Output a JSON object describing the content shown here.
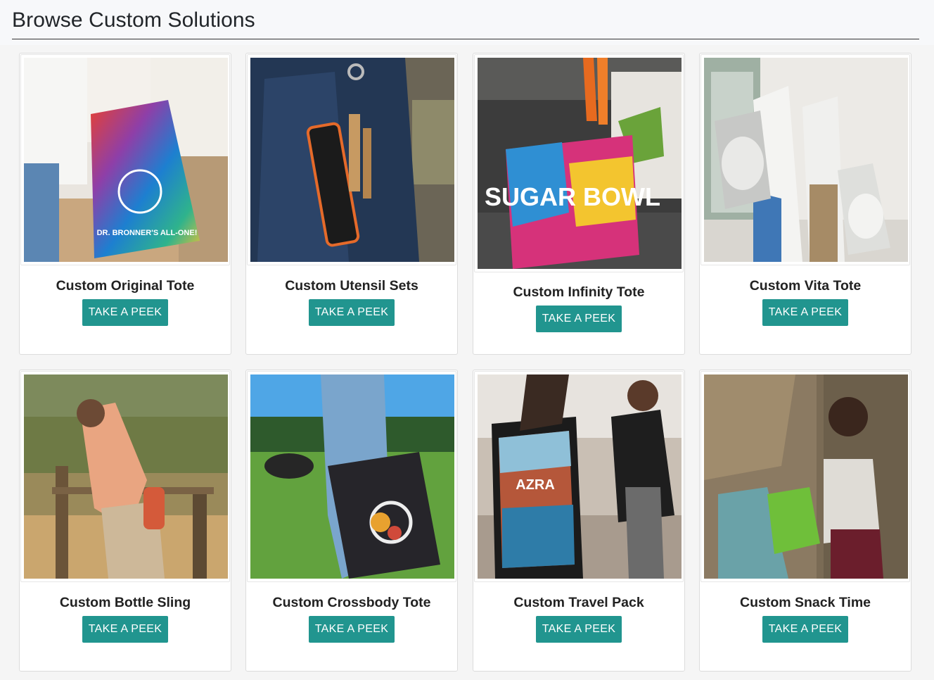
{
  "page": {
    "title": "Browse Custom Solutions"
  },
  "products": [
    {
      "name": "Custom Original Tote",
      "button_label": "TAKE A PEEK",
      "icon": "product-photo-original-tote"
    },
    {
      "name": "Custom Utensil Sets",
      "button_label": "TAKE A PEEK",
      "icon": "product-photo-utensil-sets"
    },
    {
      "name": "Custom Infinity Tote",
      "button_label": "TAKE A PEEK",
      "icon": "product-photo-infinity-tote"
    },
    {
      "name": "Custom Vita Tote",
      "button_label": "TAKE A PEEK",
      "icon": "product-photo-vita-tote"
    },
    {
      "name": "Custom Bottle Sling",
      "button_label": "TAKE A PEEK",
      "icon": "product-photo-bottle-sling"
    },
    {
      "name": "Custom Crossbody Tote",
      "button_label": "TAKE A PEEK",
      "icon": "product-photo-crossbody-tote"
    },
    {
      "name": "Custom Travel Pack",
      "button_label": "TAKE A PEEK",
      "icon": "product-photo-travel-pack"
    },
    {
      "name": "Custom Snack Time",
      "button_label": "TAKE A PEEK",
      "icon": "product-photo-snack-time"
    }
  ],
  "photo_text": {
    "original_tote": "DR. BRONNER'S ALL-ONE!",
    "infinity_tote": "SUGAR BOWL",
    "travel_pack": "AZRA"
  },
  "colors": {
    "accent": "#21958f",
    "rule": "#333333"
  }
}
